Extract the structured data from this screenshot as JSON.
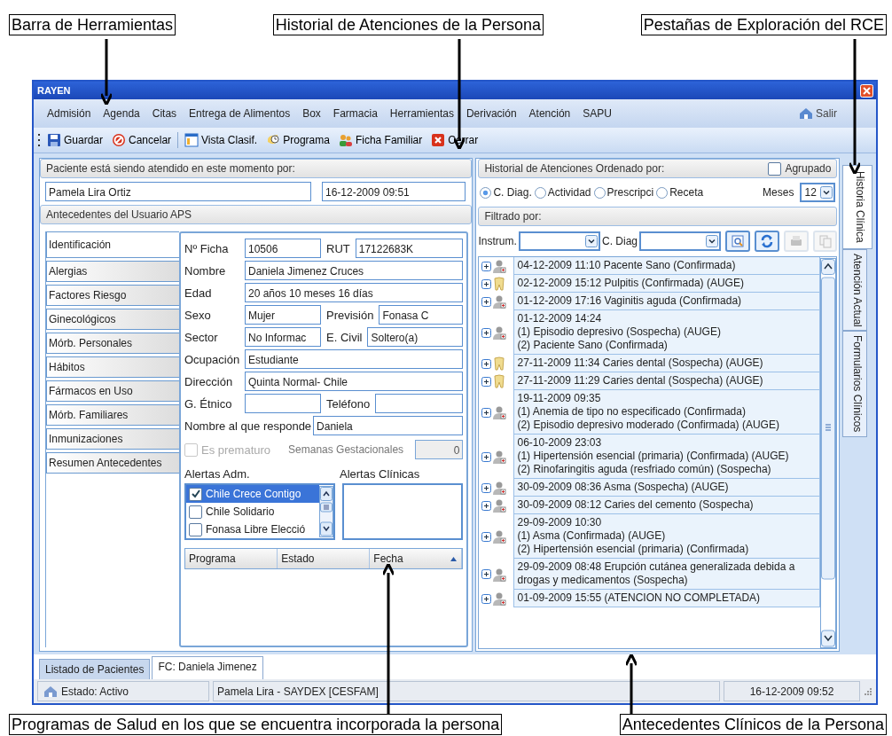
{
  "callouts_top": [
    "Barra de Herramientas",
    "Historial de Atenciones de la Persona",
    "Pestañas de Exploración del RCE"
  ],
  "window": {
    "title": "RAYEN"
  },
  "menu": [
    "Admisión",
    "Agenda",
    "Citas",
    "Entrega de Alimentos",
    "Box",
    "Farmacia",
    "Herramientas",
    "Derivación",
    "Atención",
    "SAPU"
  ],
  "exit": "Salir",
  "toolbar": [
    {
      "label": "Guardar",
      "kind": "save"
    },
    {
      "label": "Cancelar",
      "kind": "cancel"
    },
    {
      "label": "Vista Clasif.",
      "kind": "view"
    },
    {
      "label": "Programa",
      "kind": "program"
    },
    {
      "label": "Ficha Familiar",
      "kind": "family"
    },
    {
      "label": "Cerrar",
      "kind": "close"
    }
  ],
  "attending": {
    "title": "Paciente está siendo atendido en este momento por:",
    "name": "Pamela Lira Ortiz",
    "datetime": "16-12-2009 09:51"
  },
  "antecedentes": {
    "title": "Antecedentes del Usuario APS",
    "tabs": [
      {
        "label": "Identificación",
        "selected": true
      },
      {
        "label": "Alergias",
        "selected": false
      },
      {
        "label": "Factores Riesgo",
        "selected": false
      },
      {
        "label": "Ginecológicos",
        "selected": false
      },
      {
        "label": "Mórb. Personales",
        "selected": false
      },
      {
        "label": "Hábitos",
        "selected": false
      },
      {
        "label": "Fármacos en Uso",
        "selected": false
      },
      {
        "label": "Mórb. Familiares",
        "selected": false
      },
      {
        "label": "Inmunizaciones",
        "selected": false
      },
      {
        "label": "Resumen Antecedentes",
        "selected": false
      }
    ]
  },
  "identificacion": {
    "fields": [
      [
        {
          "label": "Nº Ficha",
          "value": "10506"
        },
        {
          "label": "RUT",
          "value": "17122683K"
        }
      ],
      [
        {
          "label": "Nombre",
          "value": "Daniela   Jimenez Cruces"
        }
      ],
      [
        {
          "label": "Edad",
          "value": "20 años 10 meses 16 días"
        }
      ],
      [
        {
          "label": "Sexo",
          "value": "Mujer"
        },
        {
          "label": "Previsión",
          "value": "Fonasa C"
        }
      ],
      [
        {
          "label": "Sector",
          "value": "No Informac"
        },
        {
          "label": "E. Civil",
          "value": "Soltero(a)"
        }
      ],
      [
        {
          "label": "Ocupación",
          "value": "Estudiante"
        }
      ],
      [
        {
          "label": "Dirección",
          "value": "Quinta Normal- Chile"
        }
      ],
      [
        {
          "label": "G. Étnico"
        },
        {
          "label": "Teléfono"
        }
      ],
      [
        {
          "label": "Nombre al que responde",
          "value": "Daniela"
        }
      ]
    ],
    "premature": {
      "label": "Es prematuro",
      "checked": false,
      "disabled": true
    },
    "weeks": {
      "label": "Semanas Gestacionales",
      "value": "0",
      "disabled": true
    },
    "alerts_adm": {
      "title": "Alertas Adm.",
      "items": [
        {
          "label": "Chile Crece Contigo",
          "checked": true,
          "selected": true
        },
        {
          "label": "Chile Solidario",
          "checked": false,
          "selected": false
        },
        {
          "label": "Fonasa Libre Elecció",
          "checked": false,
          "selected": false
        }
      ]
    },
    "alerts_clinical": {
      "title": "Alertas Clínicas"
    },
    "programs_table": {
      "columns": [
        {
          "label": "Programa",
          "sorted": false
        },
        {
          "label": "Estado",
          "sorted": false
        },
        {
          "label": "Fecha",
          "sorted": true
        }
      ]
    }
  },
  "history": {
    "title": "Historial de Atenciones Ordenado por:",
    "grouped": {
      "label": "Agrupado",
      "checked": false
    },
    "order": [
      {
        "label": "C. Diag.",
        "selected": true
      },
      {
        "label": "Actividad",
        "selected": false
      },
      {
        "label": "Prescripci",
        "selected": false
      },
      {
        "label": "Receta",
        "selected": false
      }
    ],
    "months": {
      "label": "Meses",
      "value": "12"
    },
    "filter_title": "Filtrado por:",
    "filters": [
      {
        "label": "Instrum."
      },
      {
        "label": "C. Diag"
      }
    ],
    "filter_buttons": [
      {
        "kind": "search",
        "disabled": false
      },
      {
        "kind": "refresh",
        "disabled": false
      },
      {
        "kind": "print",
        "disabled": true
      },
      {
        "kind": "copy",
        "disabled": true
      }
    ],
    "entries": [
      {
        "kind": "medical",
        "lines": [
          "04-12-2009 11:10 Pacente Sano (Confirmada)"
        ]
      },
      {
        "kind": "dental",
        "lines": [
          "02-12-2009 15:12 Pulpitis (Confirmada) (AUGE)"
        ]
      },
      {
        "kind": "medical",
        "lines": [
          "01-12-2009 17:16 Vaginitis aguda (Confirmada)"
        ]
      },
      {
        "kind": "medical",
        "lines": [
          "01-12-2009 14:24",
          "(1) Episodio depresivo (Sospecha) (AUGE)",
          "(2) Paciente Sano (Confirmada)"
        ]
      },
      {
        "kind": "dental",
        "lines": [
          "27-11-2009 11:34 Caries dental (Sospecha) (AUGE)"
        ]
      },
      {
        "kind": "dental",
        "lines": [
          "27-11-2009 11:29 Caries dental (Sospecha) (AUGE)"
        ]
      },
      {
        "kind": "medical",
        "lines": [
          "19-11-2009 09:35",
          "(1) Anemia de tipo no especificado (Confirmada)",
          "(2) Episodio depresivo moderado (Confirmada) (AUGE)"
        ]
      },
      {
        "kind": "medical",
        "lines": [
          "06-10-2009 23:03",
          "(1) Hipertensión esencial (primaria) (Confirmada) (AUGE)",
          "(2) Rinofaringitis aguda (resfriado común) (Sospecha)"
        ]
      },
      {
        "kind": "medical",
        "lines": [
          "30-09-2009 08:36 Asma (Sospecha) (AUGE)"
        ]
      },
      {
        "kind": "medical",
        "lines": [
          "30-09-2009 08:12 Caries del cemento (Sospecha)"
        ]
      },
      {
        "kind": "medical",
        "lines": [
          "29-09-2009 10:30",
          "(1) Asma (Confirmada) (AUGE)",
          "(2) Hipertensión esencial (primaria) (Confirmada)"
        ]
      },
      {
        "kind": "medical",
        "lines": [
          "29-09-2009 08:48 Erupción cutánea generalizada debida a drogas y medicamentos (Sospecha)"
        ]
      },
      {
        "kind": "medical",
        "lines": [
          "01-09-2009 15:55  (ATENCION NO COMPLETADA)"
        ]
      }
    ]
  },
  "side_tabs": [
    {
      "label": "Historia Clínica",
      "selected": true
    },
    {
      "label": "Atención Actual",
      "selected": false
    },
    {
      "label": "Formularios Clínicos",
      "selected": false
    }
  ],
  "bottom_tabs": [
    {
      "label": "Listado de Pacientes",
      "selected": false
    },
    {
      "label": "FC: Daniela Jimenez",
      "selected": true
    }
  ],
  "status_bar": [
    "Estado: Activo",
    "Pamela Lira - SAYDEX [CESFAM]",
    "16-12-2009 09:52"
  ],
  "callouts_bottom": [
    "Programas de Salud en los que se encuentra incorporada la persona",
    "Antecedentes Clínicos de la Persona"
  ]
}
